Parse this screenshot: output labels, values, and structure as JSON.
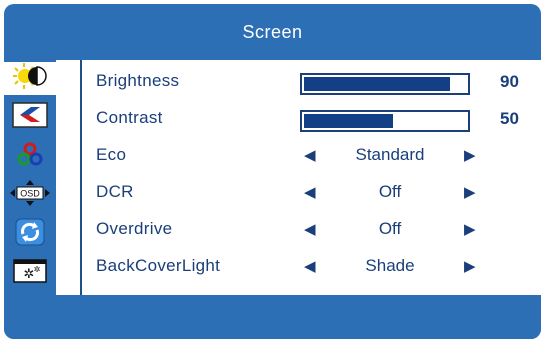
{
  "window": {
    "title": "Screen"
  },
  "sidebar": {
    "tabs": [
      {
        "icon": "brightness-sun-icon",
        "selected": true
      },
      {
        "icon": "color-image-icon",
        "selected": false
      },
      {
        "icon": "color-balance-icon",
        "selected": false
      },
      {
        "icon": "osd-settings-icon",
        "selected": false
      },
      {
        "icon": "reset-refresh-icon",
        "selected": false
      },
      {
        "icon": "misc-settings-icon",
        "selected": false
      }
    ]
  },
  "rows": {
    "brightness": {
      "label": "Brightness",
      "value": "90",
      "level": 0.9
    },
    "contrast": {
      "label": "Contrast",
      "value": "50",
      "level": 0.55
    },
    "eco": {
      "label": "Eco",
      "option": "Standard"
    },
    "dcr": {
      "label": "DCR",
      "option": "Off"
    },
    "overdrive": {
      "label": "Overdrive",
      "option": "Off"
    },
    "backcoverlight": {
      "label": "BackCoverLight",
      "option": "Shade"
    }
  },
  "glyphs": {
    "left": "◀",
    "right": "▶",
    "osd_tag": "OSD"
  },
  "colors": {
    "frame_blue": "#2d6fb5",
    "text_navy": "#1a3f7a",
    "bar_fill": "#123f85"
  }
}
